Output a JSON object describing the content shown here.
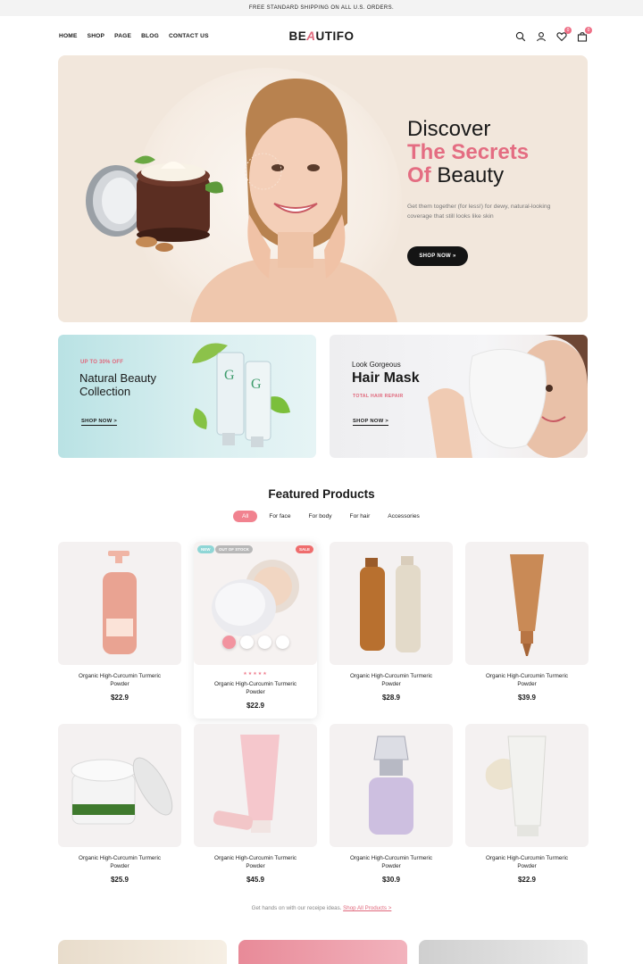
{
  "topbar": {
    "text": "FREE STANDARD SHIPPING ON ALL U.S. ORDERS."
  },
  "nav": {
    "items": [
      "HOME",
      "SHOP",
      "PAGE",
      "BLOG",
      "CONTACT US"
    ]
  },
  "logo": {
    "part1": "BE",
    "accent": "A",
    "part2": "UTIFO"
  },
  "header_icons": {
    "icons": [
      "search-icon",
      "user-icon",
      "heart-icon",
      "bag-icon"
    ],
    "wishlist_count": "0",
    "cart_count": "0"
  },
  "hero": {
    "line1": "Discover",
    "line2": "The Secrets",
    "line3_of": "Of",
    "line3_rest": "Beauty",
    "subtitle": "Get them together (for less!) for dewy, natural-looking coverage that still looks like skin",
    "button": "SHOP NOW »"
  },
  "promo1": {
    "kicker": "UP TO 30% OFF",
    "title_line1": "Natural Beauty",
    "title_line2": "Collection",
    "link": "SHOP NOW >"
  },
  "promo2": {
    "kicker": "Look Gorgeous",
    "title": "Hair Mask",
    "subtitle": "TOTAL HAIR REPAIR",
    "link": "SHOP NOW >"
  },
  "featured": {
    "title": "Featured Products",
    "tabs": [
      "All",
      "For face",
      "For body",
      "For hair",
      "Accessories"
    ],
    "active_tab": "All"
  },
  "products": [
    {
      "name": "Organic High-Curcumin Turmeric Powder",
      "price": "$22.9"
    },
    {
      "name": "Organic High-Curcumin Turmeric Powder",
      "price": "$22.9",
      "tags": [
        "NEW",
        "OUT OF STOCK",
        "SALE"
      ],
      "rating_stars": "★★★★★"
    },
    {
      "name": "Organic High-Curcumin Turmeric Powder",
      "price": "$28.9"
    },
    {
      "name": "Organic High-Curcumin Turmeric Powder",
      "price": "$39.9"
    },
    {
      "name": "Organic High-Curcumin Turmeric Powder",
      "price": "$25.9"
    },
    {
      "name": "Organic High-Curcumin Turmeric Powder",
      "price": "$45.9"
    },
    {
      "name": "Organic High-Curcumin Turmeric Powder",
      "price": "$30.9"
    },
    {
      "name": "Organic High-Curcumin Turmeric Powder",
      "price": "$22.9"
    }
  ],
  "footer_note": {
    "text": "Get hands on with our receipe ideas.",
    "link": "Shop All Products >"
  },
  "colors": {
    "accent": "#e46d82",
    "hero_bg": "#f2e7dc",
    "promo1_bg": "#c9e8ea",
    "dark": "#141414"
  }
}
